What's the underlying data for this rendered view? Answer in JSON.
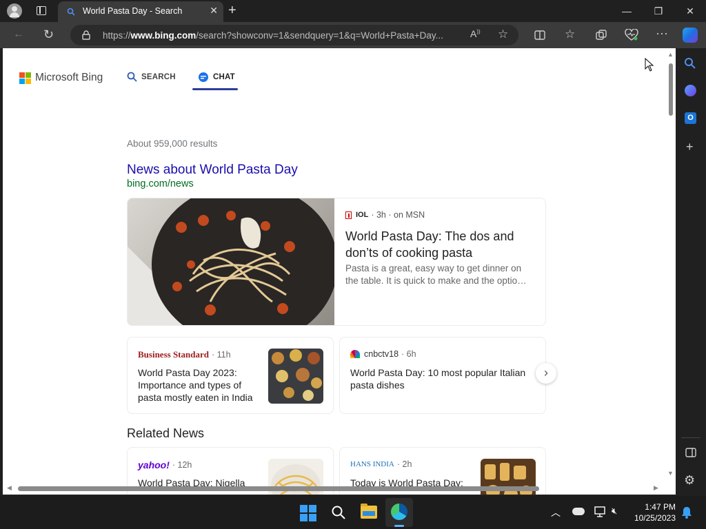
{
  "browser": {
    "tab_title": "World Pasta Day - Search",
    "url_prefix": "https://",
    "url_domain": "www.bing.com",
    "url_rest": "/search?showconv=1&sendquery=1&q=World+Pasta+Day..."
  },
  "bing": {
    "logo_text": "Microsoft Bing",
    "scope_search": "SEARCH",
    "scope_chat": "CHAT"
  },
  "results": {
    "count": "About 959,000 results",
    "news_heading": "News about World Pasta Day",
    "news_source": "bing.com/news"
  },
  "hero": {
    "publisher": "IOL",
    "age": "· 3h · on MSN",
    "title": "World Pasta Day: The dos and don’ts of cooking pasta",
    "snippet": "Pasta is a great, easy way to get dinner on the table. It is quick to make and the optio…"
  },
  "cards": [
    {
      "publisher": "Business Standard",
      "age": "· 11h",
      "title": "World Pasta Day 2023: Importance and types of pasta mostly eaten in India"
    },
    {
      "publisher": "cnbctv18",
      "age": "· 6h",
      "title": "World Pasta Day: 10 most popular Italian pasta dishes"
    }
  ],
  "related": {
    "heading": "Related News",
    "items": [
      {
        "publisher": "yahoo!",
        "age": "· 12h",
        "title": "World Pasta Day: Nigella"
      },
      {
        "publisher": "HANS INDIA",
        "age": "· 2h",
        "title": "Today is World Pasta Day:"
      }
    ]
  },
  "taskbar": {
    "time": "1:47 PM",
    "date": "10/25/2023"
  }
}
